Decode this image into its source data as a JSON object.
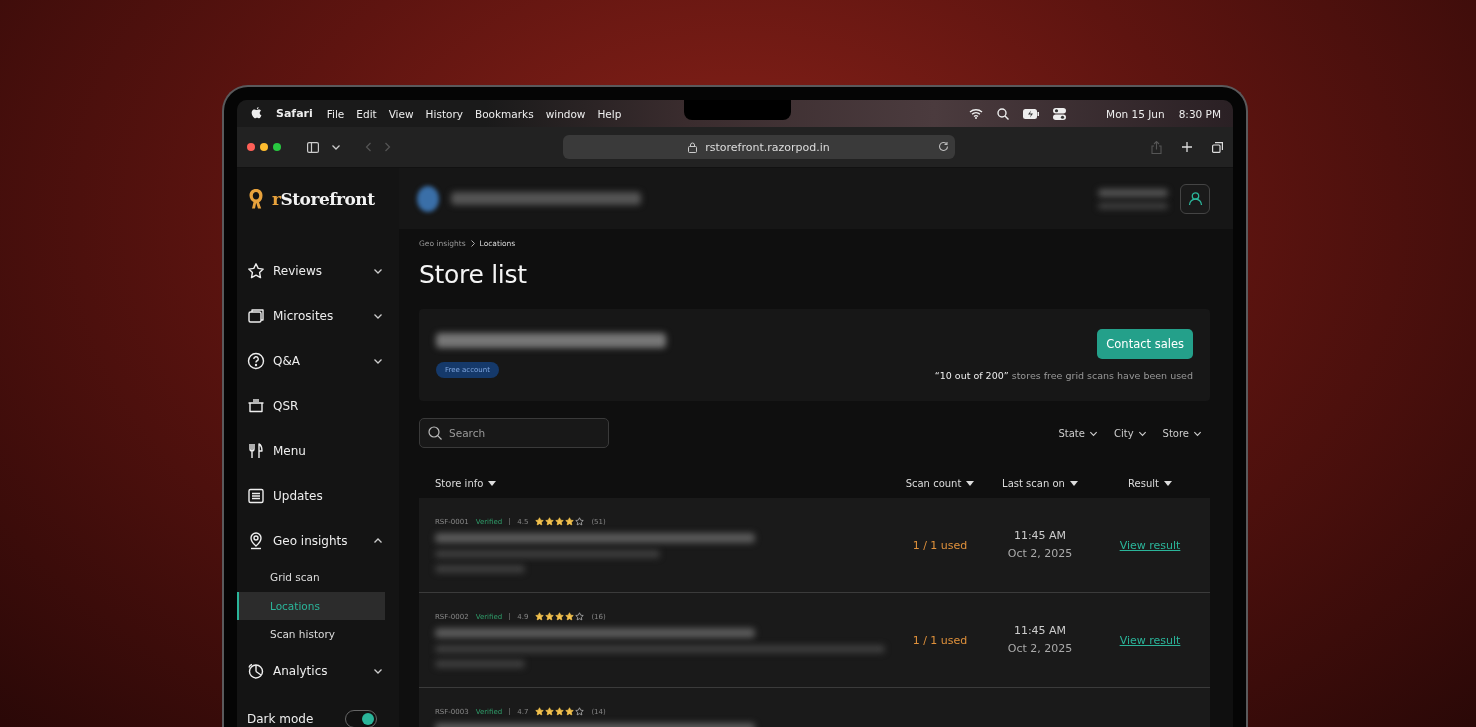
{
  "menubar": {
    "app": "Safari",
    "menus": [
      "File",
      "Edit",
      "View",
      "History",
      "Bookmarks",
      "window",
      "Help"
    ],
    "date": "Mon 15 Jun",
    "time": "8:30 PM"
  },
  "browser": {
    "url": "rstorefront.razorpod.in"
  },
  "sidebar": {
    "logo": {
      "mark": "r",
      "name": "Storefront"
    },
    "items": [
      {
        "label": "Reviews",
        "kind": "star",
        "expanded": false
      },
      {
        "label": "Microsites",
        "kind": "windows",
        "expanded": false
      },
      {
        "label": "Q&A",
        "kind": "question",
        "expanded": false
      },
      {
        "label": "QSR",
        "kind": "pot"
      },
      {
        "label": "Menu",
        "kind": "cutlery"
      },
      {
        "label": "Updates",
        "kind": "list"
      },
      {
        "label": "Geo insights",
        "kind": "pin",
        "expanded": true,
        "children": [
          {
            "label": "Grid scan",
            "selected": false
          },
          {
            "label": "Locations",
            "selected": true
          },
          {
            "label": "Scan history",
            "selected": false
          }
        ]
      },
      {
        "label": "Analytics",
        "kind": "chart",
        "expanded": false
      }
    ],
    "dark_mode": {
      "label": "Dark mode",
      "on": true
    }
  },
  "breadcrumb": [
    "Geo insights",
    "Locations"
  ],
  "title": "Store list",
  "banner": {
    "badge": "Free account",
    "button": "Contact sales",
    "note": "**“10 out of 200”** stores free grid scans have been used"
  },
  "search": {
    "placeholder": "Search"
  },
  "filters": [
    "State",
    "City",
    "Store"
  ],
  "columns": [
    "Store info",
    "Scan count",
    "Last scan on",
    "Result"
  ],
  "rows": [
    {
      "id": "RSF-0001",
      "status": "Verified",
      "rating": "4.5",
      "stars": 4,
      "count": "(51)",
      "scan": "1 / 1 used",
      "time": "11:45 AM",
      "date": "Oct 2, 2025",
      "link": "View result"
    },
    {
      "id": "RSF-0002",
      "status": "Verified",
      "rating": "4.9",
      "stars": 4,
      "count": "(16)",
      "scan": "1 / 1 used",
      "time": "11:45 AM",
      "date": "Oct 2, 2025",
      "link": "View result"
    },
    {
      "id": "RSF-0003",
      "status": "Verified",
      "rating": "4.7",
      "stars": 4,
      "count": "(14)"
    }
  ]
}
